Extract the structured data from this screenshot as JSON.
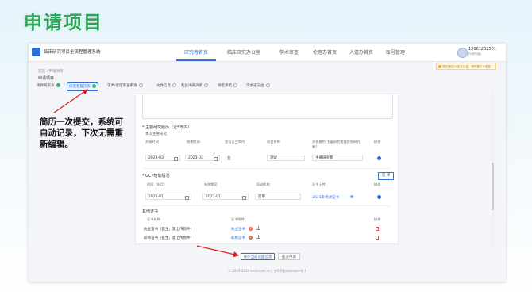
{
  "slide_title": "申请项目",
  "app": {
    "name": "临床研究项目全流程管理系统",
    "nav": [
      "研究者首页",
      "临床研究办公室",
      "学术审查",
      "伦理办首页",
      "人遗办首页",
      "账号管理"
    ],
    "user_phone": "13661202501",
    "user_role": "PI(研究者)",
    "notice": "您已通过CA实名认证，请完善个人信息"
  },
  "breadcrumb": "首页 / 申请项目",
  "page_title": "申请项目",
  "steps": [
    {
      "label": "项目概况表",
      "state": "done"
    },
    {
      "label": "研究者履历表",
      "state": "active"
    },
    {
      "label": "学术/伦理审查申请",
      "state": "todo"
    },
    {
      "label": "文件信息",
      "state": "todo"
    },
    {
      "label": "利益冲突声明",
      "state": "todo"
    },
    {
      "label": "保密承诺",
      "state": "todo"
    },
    {
      "label": "学术递交函",
      "state": "todo"
    }
  ],
  "project_section": {
    "title": "* 主要研究经历（近5年内）",
    "subtitle": "本次主要研究",
    "headers": [
      "开始时间",
      "结束时间",
      "是否已三年内",
      "项目名称",
      "承担角色(主要研究者或其他研究者)",
      "操作"
    ],
    "row": {
      "start": "2023-03",
      "end": "2023-04",
      "within3": "是",
      "name": "测试",
      "role": "主要研究者"
    }
  },
  "gcp_section": {
    "title": "* GCP培训情况",
    "select_label": "选 择",
    "headers": [
      "时间（年月）",
      "有效期至",
      "培训机构",
      "证书上传",
      "操作"
    ],
    "row": {
      "time": "2022-01",
      "valid": "2022-01",
      "org": "药审",
      "file": "2023年考试证书"
    }
  },
  "cert_section": {
    "title": "其他证书",
    "headers": [
      "证书名称",
      "证书附件",
      "操作"
    ],
    "rows": [
      {
        "name": "执业证书（医生，需上传原件）",
        "file": "执业证书"
      },
      {
        "name": "职称证书（医生，需上传原件）",
        "file": "职称证书"
      }
    ]
  },
  "buttons": {
    "save": "保存当前页面信息",
    "submit": "提交申请"
  },
  "footer": "© 2019-2024 xxxx.com.cn | 京ICP备xxxxxxxx号-1",
  "annotation": "简历一次提交，系统可自动记录，下次无需重新编辑。",
  "colors": {
    "brand": "#2f6fd6",
    "title_green": "#2aa35a",
    "done_green": "#3fae6f",
    "danger": "#e74c3c",
    "arrow_red": "#e02020"
  }
}
